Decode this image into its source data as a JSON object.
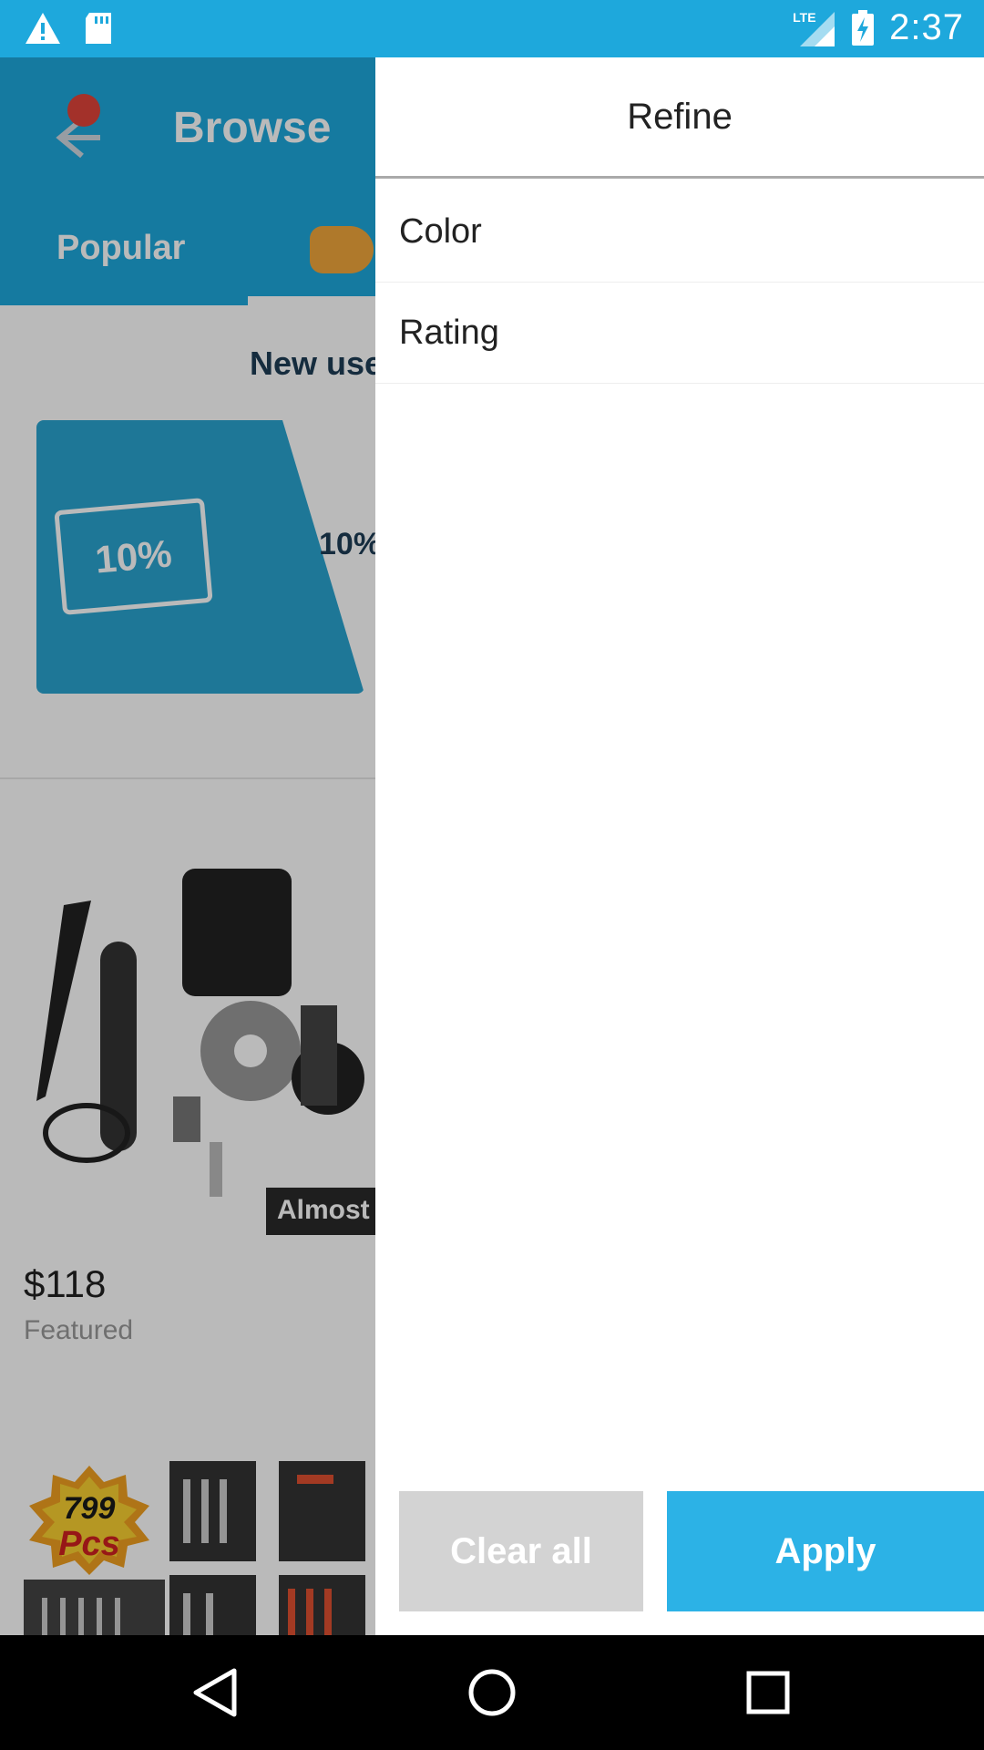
{
  "status_bar": {
    "time": "2:37",
    "network": "LTE",
    "icons": [
      "warning-icon",
      "sd-card-icon",
      "signal-icon",
      "battery-charging-icon"
    ],
    "background": "#1ea8dc"
  },
  "background_app": {
    "title": "Browse",
    "tabs": [
      "Popular"
    ],
    "promo_heading": "New use",
    "coupon_label": "10%",
    "coupon_text": "10%",
    "product": {
      "badge": "Almost",
      "price": "$118",
      "tag": "Featured"
    },
    "pcs_badge": {
      "number": "799",
      "unit": "Pcs"
    },
    "header_color": "#1ea8dc"
  },
  "drawer": {
    "title": "Refine",
    "filters": [
      {
        "label": "Color"
      },
      {
        "label": "Rating"
      }
    ],
    "clear_label": "Clear all",
    "apply_label": "Apply",
    "apply_color": "#2cb2e6",
    "clear_color": "#d3d3d3"
  },
  "nav_bar": {
    "icons": [
      "back-icon",
      "home-icon",
      "recents-icon"
    ]
  }
}
